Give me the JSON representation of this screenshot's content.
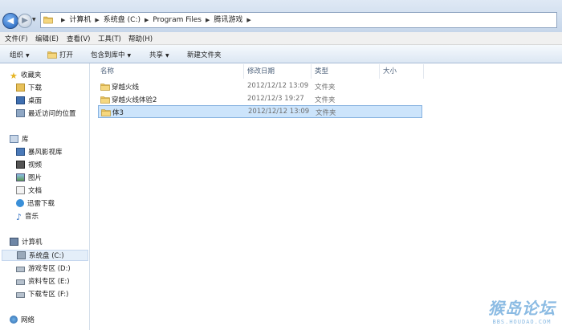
{
  "address": {
    "crumbs": [
      "计算机",
      "系统盘 (C:)",
      "Program Files",
      "腾讯游戏"
    ]
  },
  "menu": [
    "文件(F)",
    "编辑(E)",
    "查看(V)",
    "工具(T)",
    "帮助(H)"
  ],
  "toolbar": {
    "organize": "组织",
    "open": "打开",
    "include": "包含到库中",
    "share": "共享",
    "new_folder": "新建文件夹"
  },
  "nav": {
    "favorites": "收藏夹",
    "fav_items": [
      "下载",
      "桌面",
      "最近访问的位置"
    ],
    "libraries": "库",
    "lib_items": [
      "暴风影视库",
      "视频",
      "图片",
      "文档",
      "迅雷下载",
      "音乐"
    ],
    "computer": "计算机",
    "drives": [
      "系统盘 (C:)",
      "游戏专区 (D:)",
      "资料专区 (E:)",
      "下载专区 (F:)"
    ],
    "network": "网络"
  },
  "columns": {
    "name": "名称",
    "date": "修改日期",
    "type": "类型",
    "size": "大小"
  },
  "files": [
    {
      "name": "穿越火线",
      "date": "2012/12/12 13:09",
      "type": "文件夹"
    },
    {
      "name": "穿越火线体验2",
      "date": "2012/12/3 19:27",
      "type": "文件夹"
    },
    {
      "name": "体3",
      "date": "2012/12/12 13:09",
      "type": "文件夹"
    }
  ],
  "watermark": {
    "main": "猴岛论坛",
    "sub": "BBS.HOUDAO.COM"
  },
  "icons": {
    "folder": "folder-icon",
    "back": "back-arrow-icon",
    "forward": "forward-arrow-icon"
  },
  "colors": {
    "folder": "#e8c15a",
    "selection": "#cce4fb",
    "accent": "#1f5fb8"
  }
}
